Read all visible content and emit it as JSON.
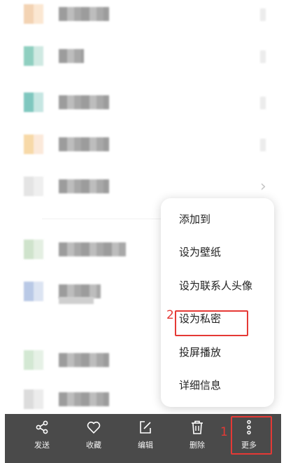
{
  "menu": {
    "items": [
      {
        "label": "添加到"
      },
      {
        "label": "设为壁纸"
      },
      {
        "label": "设为联系人头像"
      },
      {
        "label": "设为私密"
      },
      {
        "label": "投屏播放"
      },
      {
        "label": "详细信息"
      }
    ]
  },
  "annotations": {
    "step1": "1",
    "step2": "2"
  },
  "toolbar": {
    "send_label": "发送",
    "favorite_label": "收藏",
    "edit_label": "编辑",
    "delete_label": "删除",
    "more_label": "更多"
  },
  "colors": {
    "highlight": "#e53935",
    "toolbar_bg": "#4a4a4a"
  }
}
